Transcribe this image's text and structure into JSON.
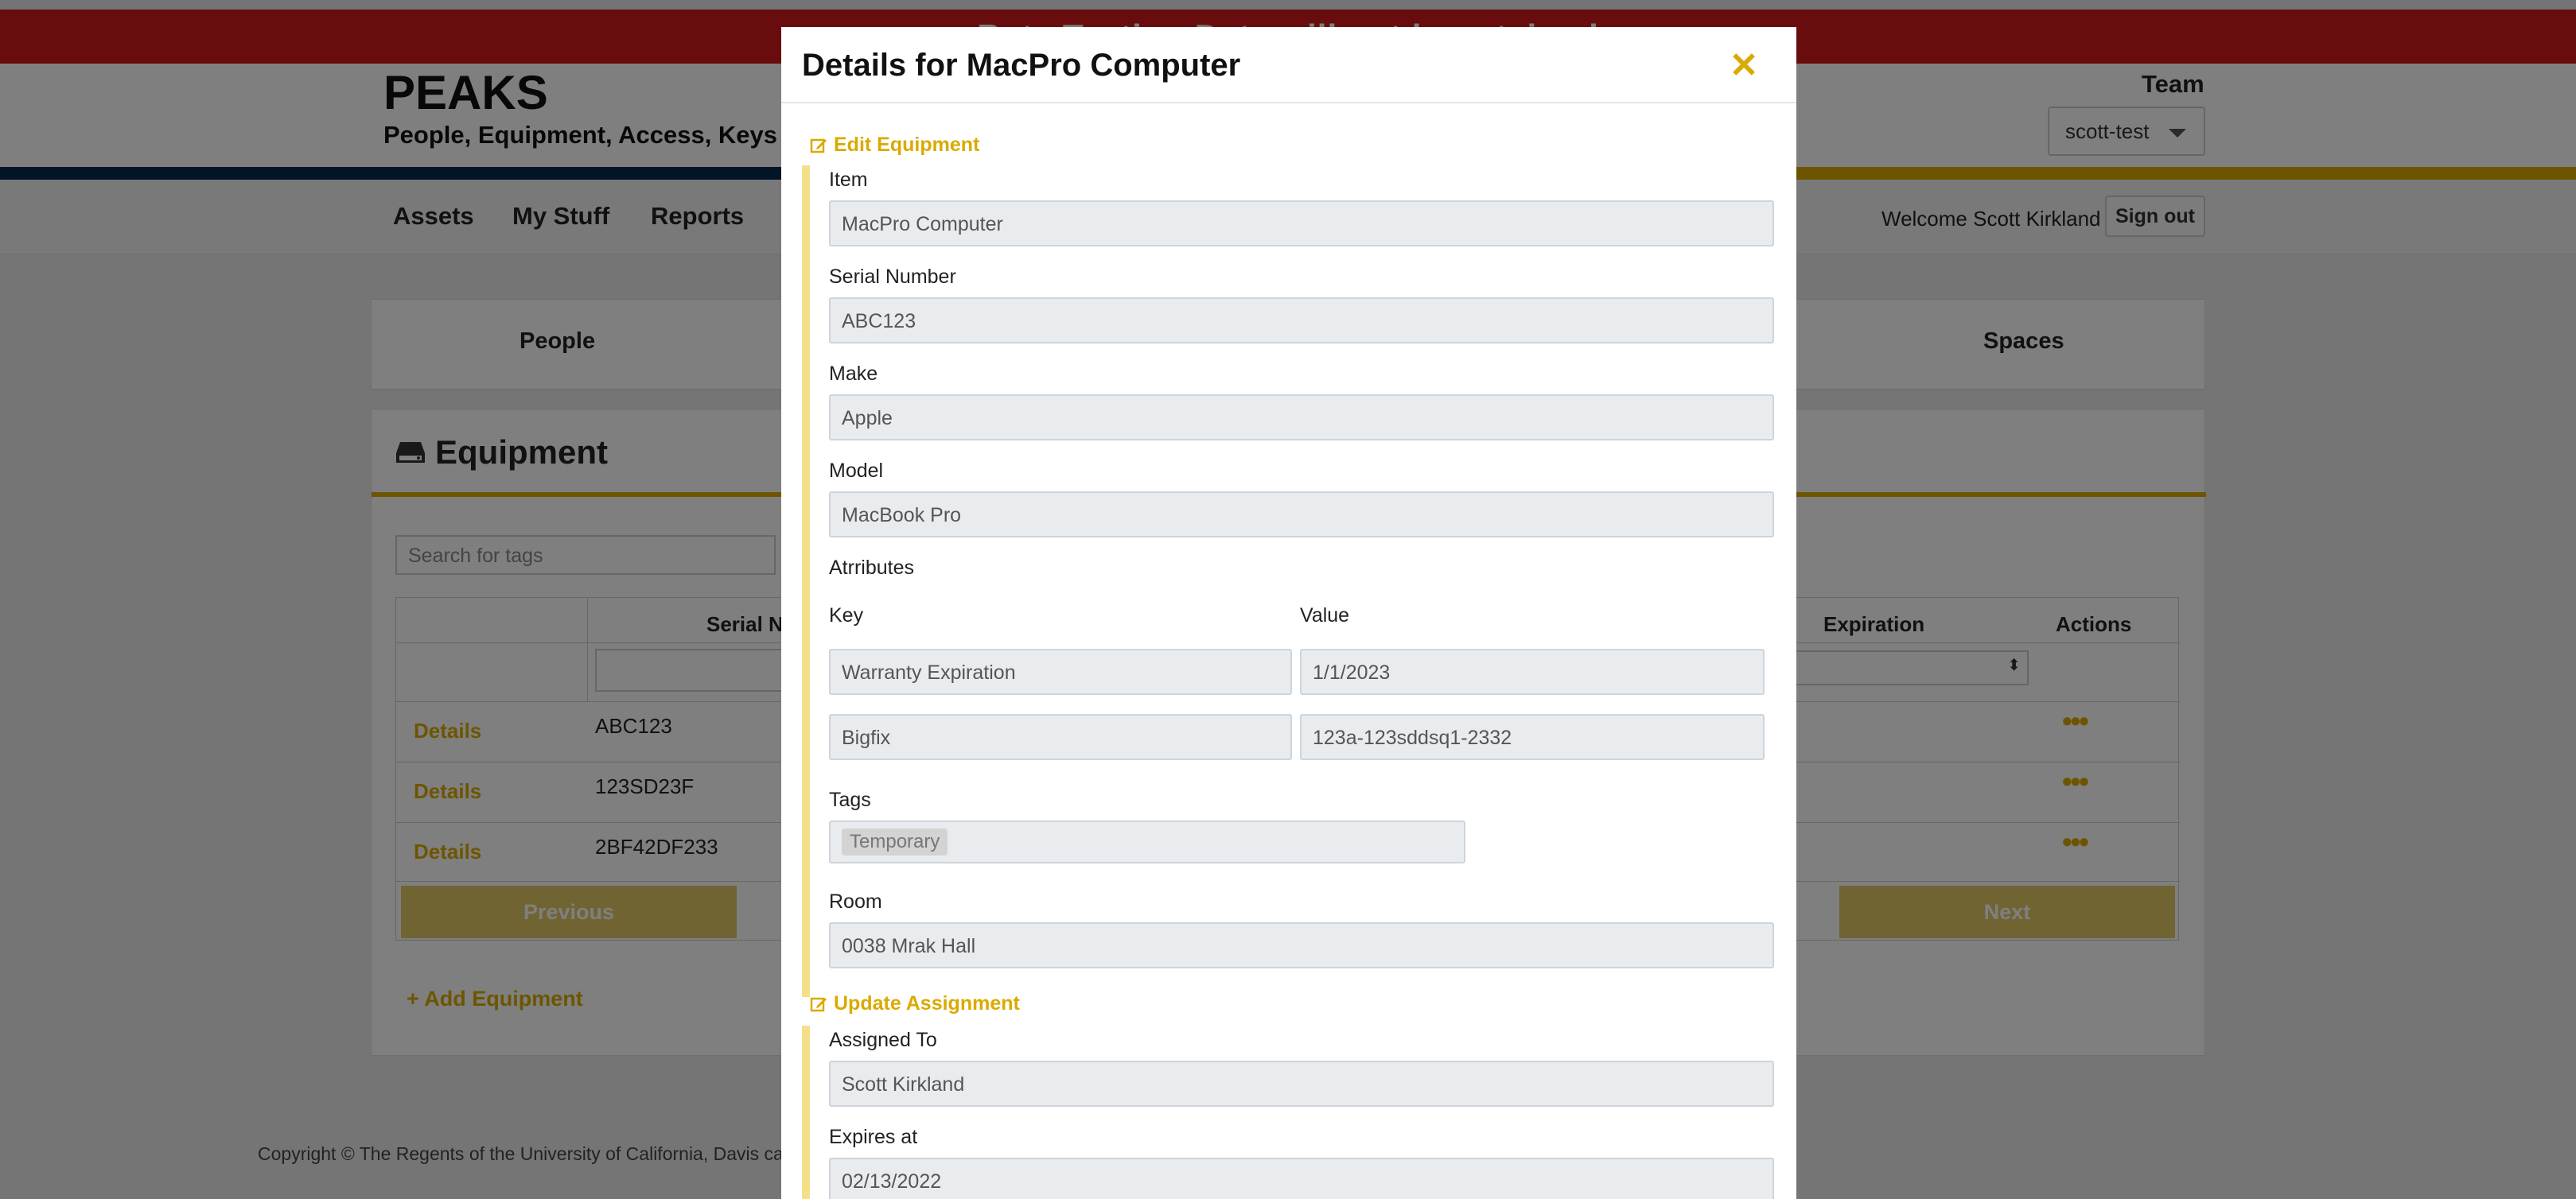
{
  "banner": {
    "text": "----- Beta Testing Data will not be retained -----"
  },
  "header": {
    "title": "PEAKS",
    "subtitle": "People, Equipment, Access, Keys and Spaces",
    "team_label": "Team",
    "team_value": "scott-test"
  },
  "nav": {
    "items": [
      {
        "label": "Assets"
      },
      {
        "label": "My Stuff"
      },
      {
        "label": "Reports"
      }
    ],
    "welcome": "Welcome Scott Kirkland",
    "signout": "Sign out"
  },
  "tabs": [
    {
      "label": "People"
    },
    {
      "label": "Spaces"
    }
  ],
  "equipment_panel": {
    "title": "Equipment",
    "search_placeholder": "Search for tags",
    "columns": [
      "Serial Nu",
      "Expiration",
      "Actions"
    ],
    "rows": [
      {
        "link": "Details",
        "serial": "ABC123"
      },
      {
        "link": "Details",
        "serial": "123SD23F"
      },
      {
        "link": "Details",
        "serial": "2BF42DF233"
      }
    ],
    "previous": "Previous",
    "next": "Next",
    "add": "Add Equipment"
  },
  "footer": {
    "text": "Copyright © The Regents of the University of California, Davis campus."
  },
  "modal": {
    "title": "Details for MacPro Computer",
    "edit_section": "Edit Equipment",
    "fields": {
      "item_label": "Item",
      "item_value": "MacPro Computer",
      "serial_label": "Serial Number",
      "serial_value": "ABC123",
      "make_label": "Make",
      "make_value": "Apple",
      "model_label": "Model",
      "model_value": "MacBook Pro",
      "attributes_label": "Atrributes",
      "key_header": "Key",
      "value_header": "Value",
      "attributes": [
        {
          "key": "Warranty Expiration",
          "value": "1/1/2023"
        },
        {
          "key": "Bigfix",
          "value": "123a-123sddsq1-2332"
        }
      ],
      "tags_label": "Tags",
      "tag_chip": "Temporary",
      "room_label": "Room",
      "room_value": "0038 Mrak Hall"
    },
    "assign_section": "Update Assignment",
    "assignment": {
      "assigned_label": "Assigned To",
      "assigned_value": "Scott Kirkland",
      "expires_label": "Expires at",
      "expires_value": "02/13/2022"
    }
  },
  "colors": {
    "accent": "#daaa00",
    "navy": "#022851",
    "banner_red": "#d2191a",
    "overlay": "rgba(0,0,0,0.5)"
  }
}
